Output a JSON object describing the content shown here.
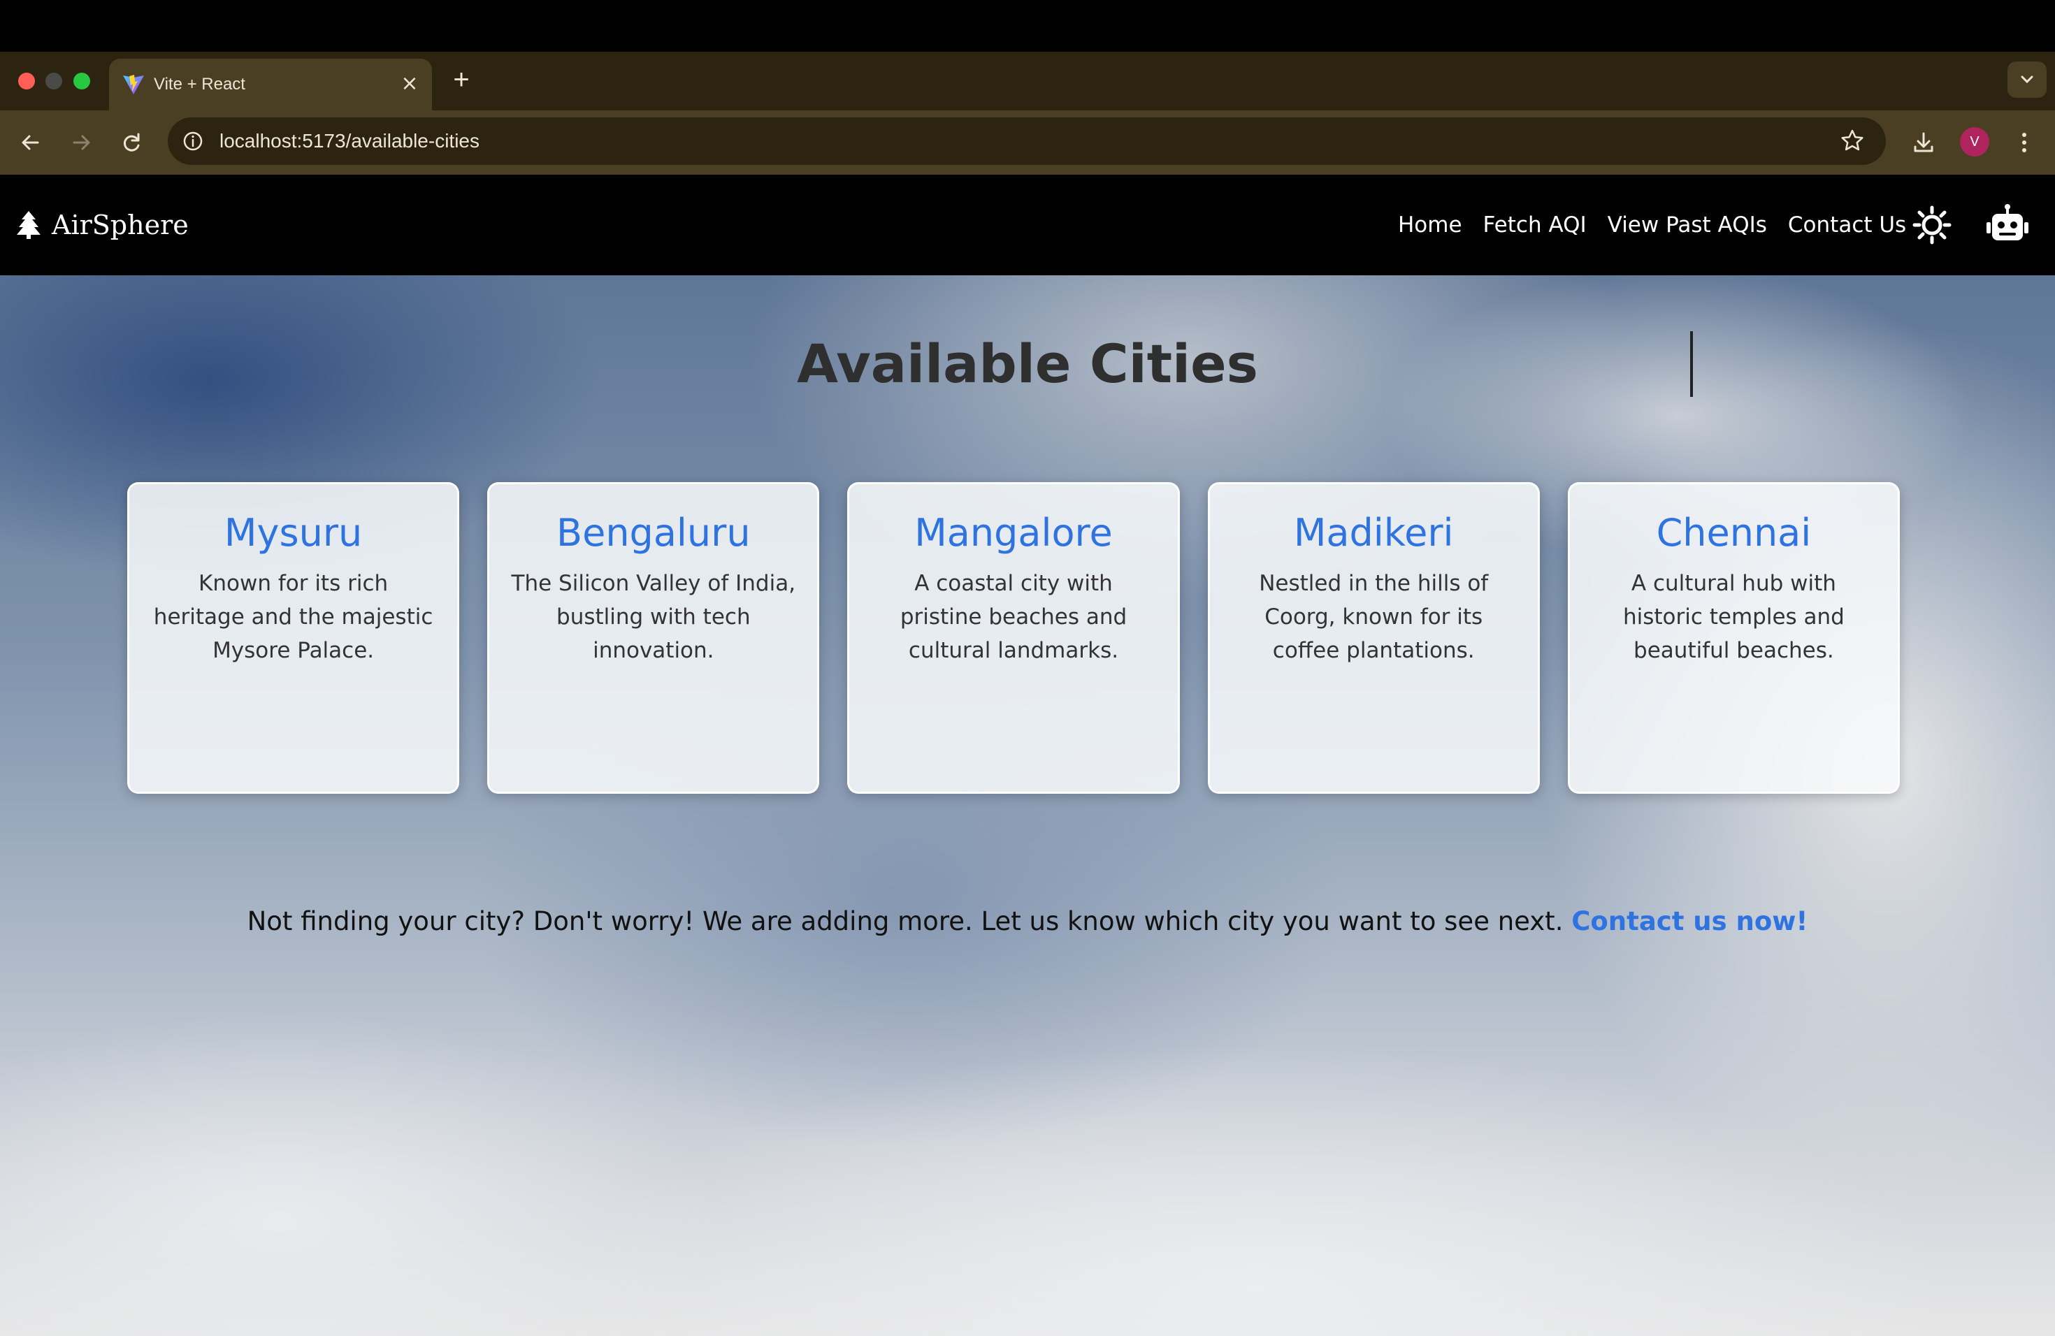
{
  "browser": {
    "tab_title": "Vite + React",
    "url": "localhost:5173/available-cities",
    "profile_initial": "V"
  },
  "app": {
    "brand": "AirSphere",
    "nav": [
      {
        "label": "Home"
      },
      {
        "label": "Fetch AQI"
      },
      {
        "label": "View Past AQIs"
      },
      {
        "label": "Contact Us"
      }
    ]
  },
  "page": {
    "title": "Available Cities",
    "cities": [
      {
        "name": "Mysuru",
        "description": "Known for its rich heritage and the majestic Mysore Palace."
      },
      {
        "name": "Bengaluru",
        "description": "The Silicon Valley of India, bustling with tech innovation."
      },
      {
        "name": "Mangalore",
        "description": "A coastal city with pristine beaches and cultural landmarks."
      },
      {
        "name": "Madikeri",
        "description": "Nestled in the hills of Coorg, known for its coffee plantations."
      },
      {
        "name": "Chennai",
        "description": "A cultural hub with historic temples and beautiful beaches."
      }
    ],
    "footer_text": "Not finding your city? Don't worry! We are adding more. Let us know which city you want to see next.",
    "footer_link": "Contact us now!"
  },
  "icons": {
    "brand": "tree-icon",
    "theme_toggle": "sun-icon",
    "chatbot": "robot-icon"
  },
  "colors": {
    "accent": "#2f73e0",
    "header_bg": "#000000",
    "chrome_bg": "#4a3f22"
  }
}
